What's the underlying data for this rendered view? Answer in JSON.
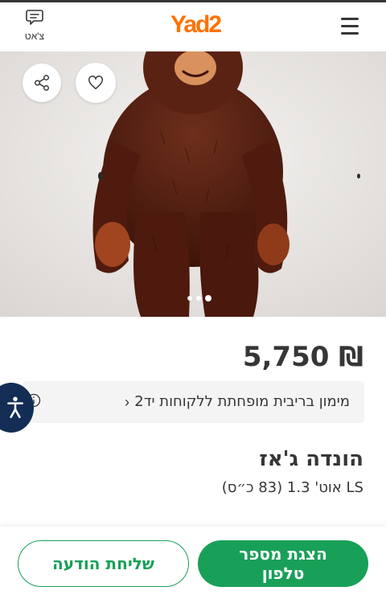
{
  "header": {
    "chat_label": "צ'אט",
    "logo_text": "Yad2",
    "logo_color": "#ff7100"
  },
  "gallery": {
    "total_images": 3,
    "active_index": 2
  },
  "listing": {
    "price": "₪ 5,750",
    "finance_text": "מימון בריבית מופחתת ללקוחות יד2",
    "finance_chevron": "›",
    "title": "הונדה ג'אז",
    "subtitle": "LS אוט' 1.3 (83 כ״ס)"
  },
  "actions": {
    "phone_label": "הצגת מספר טלפון",
    "message_label": "שליחת הודעה",
    "accent_color": "#18a058"
  },
  "icons": {
    "chat": "chat-bubble-icon",
    "menu": "hamburger-menu-icon",
    "share": "share-icon",
    "favorite": "heart-icon",
    "info": "info-icon",
    "accessibility": "accessibility-icon"
  }
}
